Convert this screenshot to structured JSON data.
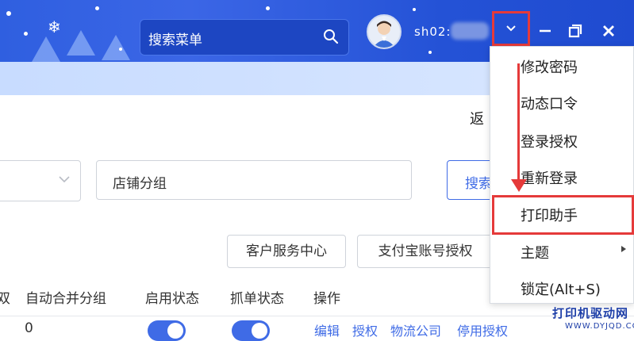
{
  "header": {
    "search_placeholder": "搜索菜单",
    "username": "sh02:"
  },
  "toolbar": {
    "back_label": "返",
    "group_placeholder": "店铺分组",
    "search_button": "搜索"
  },
  "buttons": {
    "customer_center": "客户服务中心",
    "alipay_auth": "支付宝账号授权"
  },
  "table": {
    "headers": [
      "双",
      "自动合并分组",
      "启用状态",
      "抓单状态",
      "操作"
    ],
    "row": {
      "merge_group": "0",
      "actions": [
        "编辑",
        "授权",
        "物流公司",
        "停用授权"
      ]
    }
  },
  "menu": {
    "items": [
      "修改密码",
      "动态口令",
      "登录授权",
      "重新登录",
      "打印助手",
      "主题",
      "锁定(Alt+S)"
    ],
    "highlighted_item": "打印助手"
  },
  "watermark": {
    "title": "打印机驱动网",
    "url": "WWW.DYJQD.COM"
  },
  "colors": {
    "header_blue": "#2f5fe0",
    "accent": "#3f6be6",
    "annotation_red": "#e53a3a"
  }
}
